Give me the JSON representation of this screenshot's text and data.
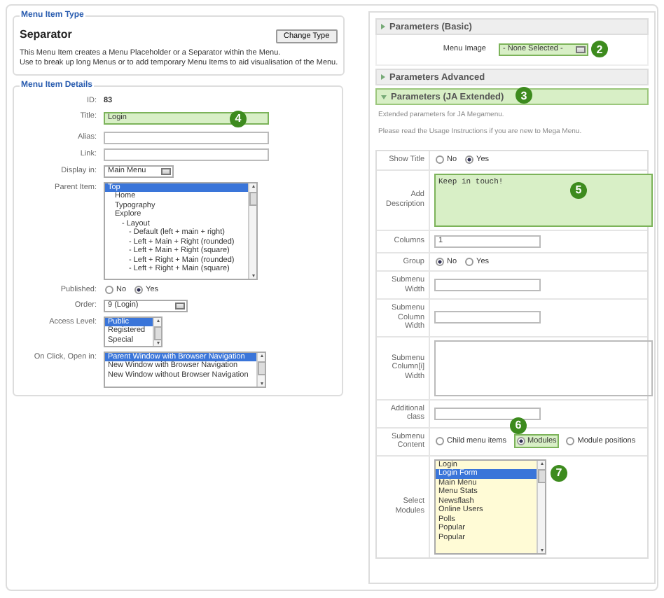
{
  "left": {
    "type_section": {
      "legend": "Menu Item Type",
      "heading": "Separator",
      "button": "Change Type",
      "lines": [
        "This Menu Item creates a Menu Placeholder or a Separator within the Menu.",
        "Use to break up long Menus or to add temporary Menu Items to aid visualisation of the Menu."
      ]
    },
    "details": {
      "legend": "Menu Item Details",
      "fields": [
        {
          "kind": "static",
          "label": "ID:",
          "value": "83"
        },
        {
          "kind": "text",
          "label": "Title:",
          "value": "Login",
          "highlighted": true,
          "badge": "4"
        },
        {
          "kind": "text",
          "label": "Alias:"
        },
        {
          "kind": "text",
          "label": "Link:"
        },
        {
          "kind": "select",
          "label": "Display in:",
          "value": "Main Menu"
        },
        {
          "kind": "list",
          "label": "Parent Item:",
          "items": [
            {
              "label": "Top",
              "selected": true,
              "children": [
                {
                  "label": "Home",
                  "selected": false
                },
                {
                  "label": "Typography",
                  "selected": false
                },
                {
                  "label": "Explore",
                  "selected": false,
                  "children": [
                    {
                      "label": "- Layout",
                      "selected": false,
                      "children": [
                        {
                          "label": "- Default (left + main + right)",
                          "selected": false
                        },
                        {
                          "label": "- Left + Main + Right (rounded)",
                          "selected": false
                        },
                        {
                          "label": "- Left + Main + Right (square)",
                          "selected": false
                        },
                        {
                          "label": "- Left + Right + Main (rounded)",
                          "selected": false
                        },
                        {
                          "label": "- Left + Right + Main (square)",
                          "selected": false
                        }
                      ]
                    }
                  ]
                }
              ]
            }
          ]
        },
        {
          "kind": "radio",
          "label": "Published:",
          "options": [
            {
              "label": "No",
              "selected": false
            },
            {
              "label": "Yes",
              "selected": true
            }
          ]
        },
        {
          "kind": "select",
          "label": "Order:",
          "value": "9 (Login)"
        },
        {
          "kind": "list",
          "label": "Access Level:",
          "items": [
            {
              "label": "Public",
              "selected": true
            },
            {
              "label": "Registered",
              "selected": false
            },
            {
              "label": "Special",
              "selected": false
            }
          ]
        },
        {
          "kind": "list",
          "label": "On Click, Open in:",
          "items": [
            {
              "label": "Parent Window with Browser Navigation",
              "selected": true
            },
            {
              "label": "New Window with Browser Navigation",
              "selected": false
            },
            {
              "label": "New Window without Browser Navigation",
              "selected": false
            }
          ]
        }
      ]
    }
  },
  "right": {
    "panels": [
      {
        "title": "Parameters (Basic)",
        "expanded": false,
        "fields": [
          {
            "kind": "select",
            "label": "Menu Image",
            "value": "- None Selected -",
            "highlighted": true,
            "badge": "2"
          }
        ]
      },
      {
        "title": "Parameters Advanced",
        "expanded": false
      },
      {
        "title": "Parameters (JA Extended)",
        "expanded": true,
        "badge": "3",
        "intro": [
          "Extended parameters for JA Megamenu.",
          "Please read the Usage Instructions if you are new to Mega Menu."
        ],
        "fields": [
          {
            "kind": "radio",
            "label": "Show Title",
            "options": [
              {
                "label": "No",
                "selected": false
              },
              {
                "label": "Yes",
                "selected": true
              }
            ]
          },
          {
            "kind": "textarea",
            "label": "Add Description",
            "value": "Keep in touch!",
            "highlighted": true,
            "badge": "5"
          },
          {
            "kind": "text",
            "label": "Columns",
            "value": "1"
          },
          {
            "kind": "radio",
            "label": "Group",
            "options": [
              {
                "label": "No",
                "selected": true
              },
              {
                "label": "Yes",
                "selected": false
              }
            ]
          },
          {
            "kind": "text",
            "label": "Submenu Width"
          },
          {
            "kind": "text",
            "label": "Submenu Column Width"
          },
          {
            "kind": "textarea",
            "label": "Submenu Column[i] Width"
          },
          {
            "kind": "text",
            "label": "Additional class"
          },
          {
            "kind": "radio",
            "label": "Submenu Content",
            "options": [
              {
                "label": "Child menu items",
                "selected": false
              },
              {
                "label": "Modules",
                "selected": true,
                "highlighted": true,
                "badge": "6"
              },
              {
                "label": "Module positions",
                "selected": false
              }
            ]
          },
          {
            "kind": "list",
            "label": "Select Modules",
            "badge": "7",
            "items": [
              {
                "label": "Login",
                "selected": false
              },
              {
                "label": "Login Form",
                "selected": true
              },
              {
                "label": "Main Menu",
                "selected": false
              },
              {
                "label": "Menu Stats",
                "selected": false
              },
              {
                "label": "Newsflash",
                "selected": false
              },
              {
                "label": "Online Users",
                "selected": false
              },
              {
                "label": "Polls",
                "selected": false
              },
              {
                "label": "Popular",
                "selected": false
              },
              {
                "label": "Popular",
                "selected": false
              }
            ]
          }
        ]
      }
    ]
  }
}
